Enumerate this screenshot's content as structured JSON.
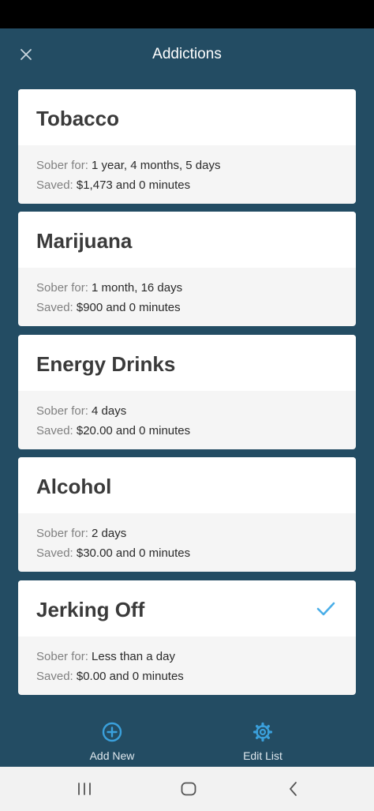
{
  "header": {
    "title": "Addictions"
  },
  "labels": {
    "sober_for": "Sober for:",
    "saved": "Saved:"
  },
  "addictions": [
    {
      "name": "Tobacco",
      "sober_for": "1 year, 4 months, 5 days",
      "saved": "$1,473 and 0 minutes",
      "selected": false
    },
    {
      "name": "Marijuana",
      "sober_for": "1 month, 16 days",
      "saved": "$900 and 0 minutes",
      "selected": false
    },
    {
      "name": "Energy Drinks",
      "sober_for": "4 days",
      "saved": "$20.00 and 0 minutes",
      "selected": false
    },
    {
      "name": "Alcohol",
      "sober_for": "2 days",
      "saved": "$30.00 and 0 minutes",
      "selected": false
    },
    {
      "name": "Jerking Off",
      "sober_for": "Less than a day",
      "saved": "$0.00 and 0 minutes",
      "selected": true
    }
  ],
  "actions": {
    "add_new": "Add New",
    "edit_list": "Edit List"
  },
  "colors": {
    "background": "#234c63",
    "accent": "#3aa0dc",
    "check": "#4aaee8"
  },
  "icons": {
    "close": "close-icon",
    "add": "add-circle-icon",
    "settings": "gear-icon",
    "selected": "checkmark-icon"
  }
}
